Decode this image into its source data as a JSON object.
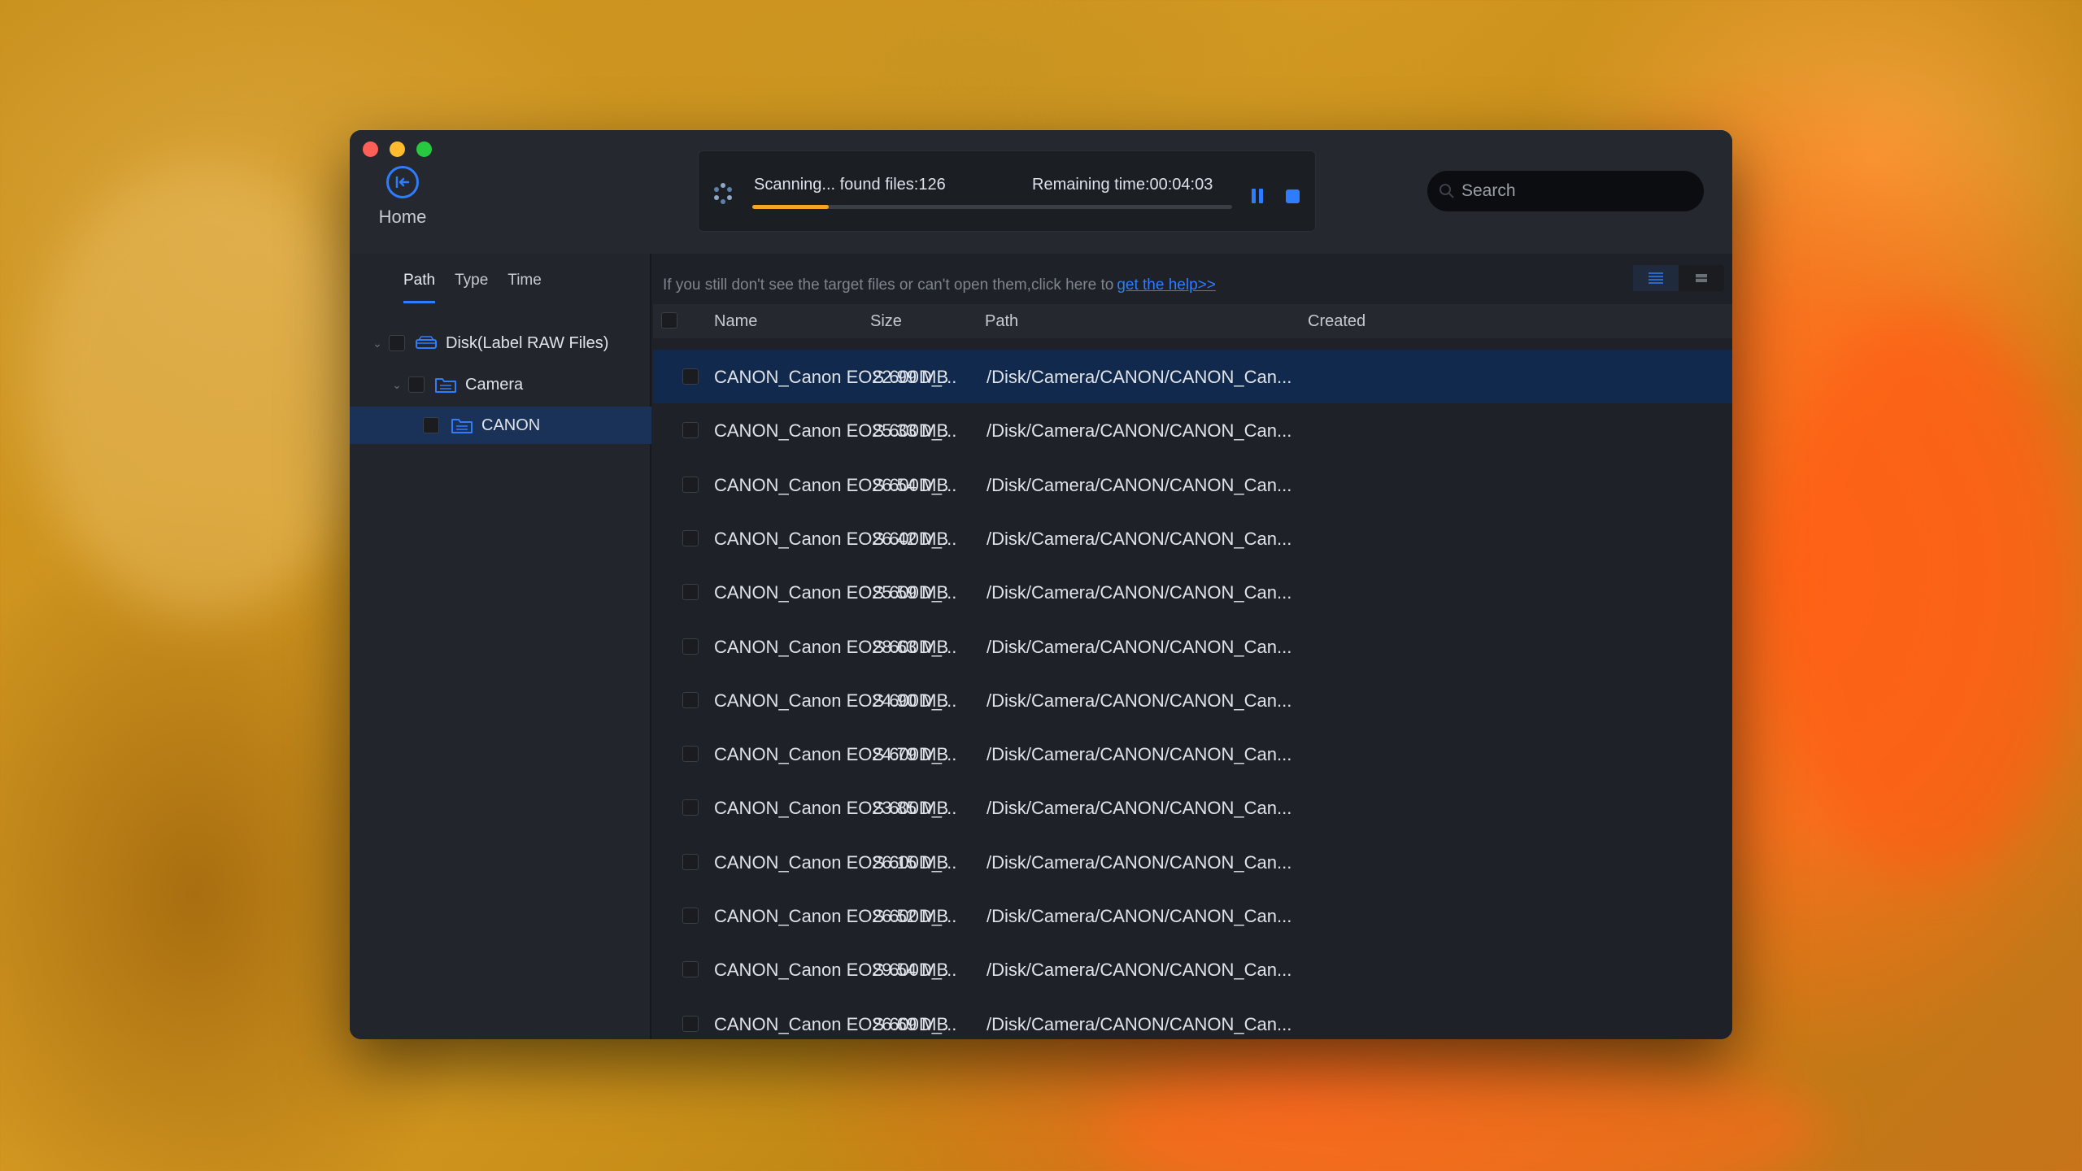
{
  "window": {
    "home_label": "Home"
  },
  "scan": {
    "status": "Scanning... found files:126",
    "remaining": "Remaining time:00:04:03",
    "progress_percent": 16
  },
  "search": {
    "placeholder": "Search"
  },
  "sidebar": {
    "tabs": [
      "Path",
      "Type",
      "Time"
    ],
    "active_tab": "Path",
    "tree": [
      {
        "label": "Disk(Label RAW Files)",
        "level": 0,
        "icon": "disk-icon"
      },
      {
        "label": "Camera",
        "level": 1,
        "icon": "folder-icon"
      },
      {
        "label": "CANON",
        "level": 2,
        "icon": "folder-icon",
        "selected": true
      }
    ]
  },
  "main": {
    "hint_text": "If you still don't see the target files or can't open them,click here to",
    "hint_link": "get the help>>",
    "columns": {
      "name": "Name",
      "size": "Size",
      "path": "Path",
      "created": "Created"
    },
    "rows": [
      {
        "name": "CANON_Canon EOS 600D_...",
        "size": "22.99 MB",
        "path": "/Disk/Camera/CANON/CANON_Can...",
        "selected": true
      },
      {
        "name": "CANON_Canon EOS 600D_...",
        "size": "25.33 MB",
        "path": "/Disk/Camera/CANON/CANON_Can..."
      },
      {
        "name": "CANON_Canon EOS 600D_...",
        "size": "26.54 MB",
        "path": "/Disk/Camera/CANON/CANON_Can..."
      },
      {
        "name": "CANON_Canon EOS 600D_...",
        "size": "26.42 MB",
        "path": "/Disk/Camera/CANON/CANON_Can..."
      },
      {
        "name": "CANON_Canon EOS 600D_...",
        "size": "25.59 MB",
        "path": "/Disk/Camera/CANON/CANON_Can..."
      },
      {
        "name": "CANON_Canon EOS 600D_...",
        "size": "28.63 MB",
        "path": "/Disk/Camera/CANON/CANON_Can..."
      },
      {
        "name": "CANON_Canon EOS 600D_...",
        "size": "24.90 MB",
        "path": "/Disk/Camera/CANON/CANON_Can..."
      },
      {
        "name": "CANON_Canon EOS 600D_...",
        "size": "24.79 MB",
        "path": "/Disk/Camera/CANON/CANON_Can..."
      },
      {
        "name": "CANON_Canon EOS 600D_...",
        "size": "23.85 MB",
        "path": "/Disk/Camera/CANON/CANON_Can..."
      },
      {
        "name": "CANON_Canon EOS 600D_...",
        "size": "26.15 MB",
        "path": "/Disk/Camera/CANON/CANON_Can..."
      },
      {
        "name": "CANON_Canon EOS 600D_...",
        "size": "26.52 MB",
        "path": "/Disk/Camera/CANON/CANON_Can..."
      },
      {
        "name": "CANON_Canon EOS 600D_...",
        "size": "29.54 MB",
        "path": "/Disk/Camera/CANON/CANON_Can..."
      },
      {
        "name": "CANON_Canon EOS 600D_...",
        "size": "26.69 MB",
        "path": "/Disk/Camera/CANON/CANON_Can..."
      }
    ]
  },
  "colors": {
    "accent": "#2e7dff",
    "progress": "#f2a422",
    "selected_row": "#10294d",
    "window_bg": "#1e2127"
  }
}
